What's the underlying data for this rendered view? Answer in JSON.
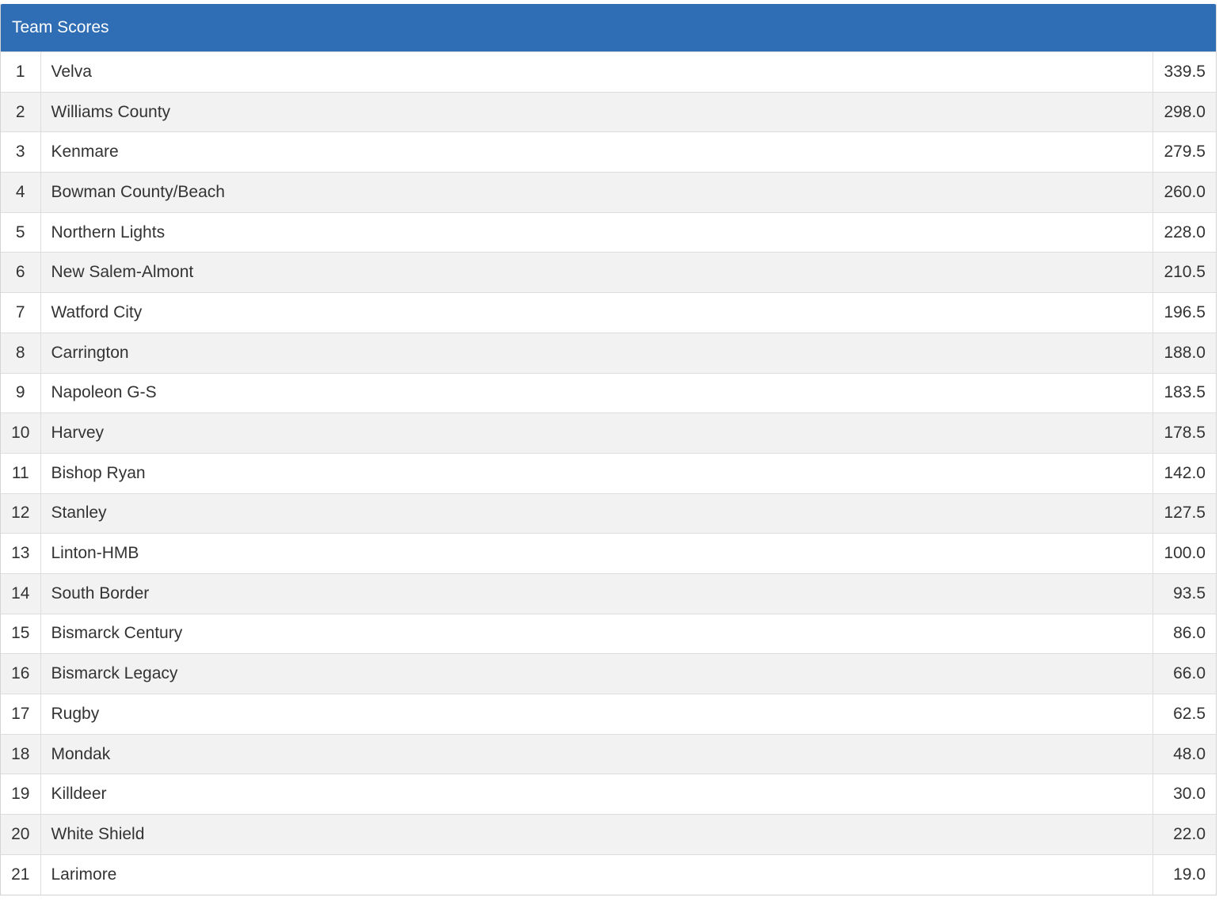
{
  "header": {
    "title": "Team Scores"
  },
  "table": {
    "rows": [
      {
        "rank": "1",
        "team": "Velva",
        "score": "339.5"
      },
      {
        "rank": "2",
        "team": "Williams County",
        "score": "298.0"
      },
      {
        "rank": "3",
        "team": "Kenmare",
        "score": "279.5"
      },
      {
        "rank": "4",
        "team": "Bowman County/Beach",
        "score": "260.0"
      },
      {
        "rank": "5",
        "team": "Northern Lights",
        "score": "228.0"
      },
      {
        "rank": "6",
        "team": "New Salem-Almont",
        "score": "210.5"
      },
      {
        "rank": "7",
        "team": "Watford City",
        "score": "196.5"
      },
      {
        "rank": "8",
        "team": "Carrington",
        "score": "188.0"
      },
      {
        "rank": "9",
        "team": "Napoleon G-S",
        "score": "183.5"
      },
      {
        "rank": "10",
        "team": "Harvey",
        "score": "178.5"
      },
      {
        "rank": "11",
        "team": "Bishop Ryan",
        "score": "142.0"
      },
      {
        "rank": "12",
        "team": "Stanley",
        "score": "127.5"
      },
      {
        "rank": "13",
        "team": "Linton-HMB",
        "score": "100.0"
      },
      {
        "rank": "14",
        "team": "South Border",
        "score": "93.5"
      },
      {
        "rank": "15",
        "team": "Bismarck Century",
        "score": "86.0"
      },
      {
        "rank": "16",
        "team": "Bismarck Legacy",
        "score": "66.0"
      },
      {
        "rank": "17",
        "team": "Rugby",
        "score": "62.5"
      },
      {
        "rank": "18",
        "team": "Mondak",
        "score": "48.0"
      },
      {
        "rank": "19",
        "team": "Killdeer",
        "score": "30.0"
      },
      {
        "rank": "20",
        "team": "White Shield",
        "score": "22.0"
      },
      {
        "rank": "21",
        "team": "Larimore",
        "score": "19.0"
      }
    ]
  },
  "colors": {
    "header_bg": "#2f6eb5",
    "header_text": "#ffffff",
    "row_alt": "#f2f2f2",
    "text": "#333333"
  }
}
